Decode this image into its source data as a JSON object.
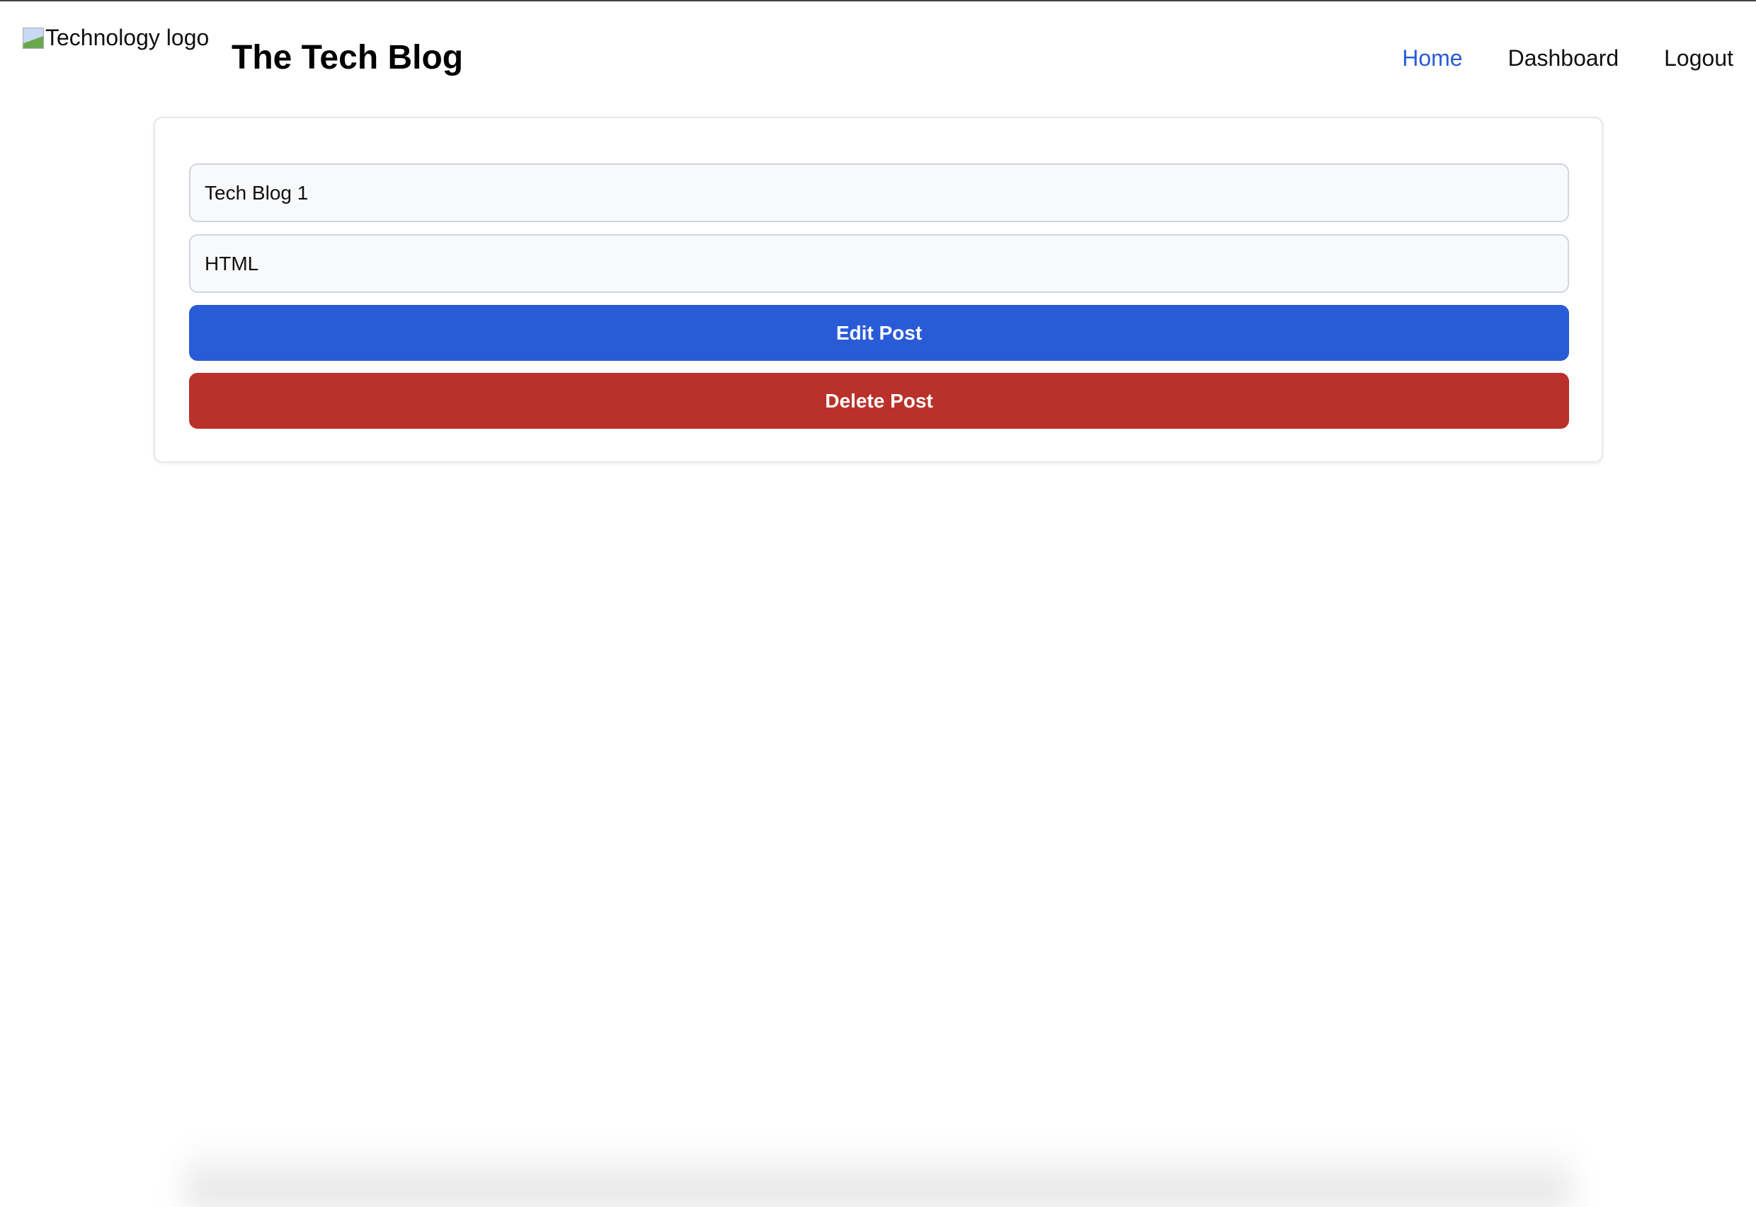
{
  "header": {
    "logo_alt": "Technology logo",
    "title": "The Tech Blog",
    "nav": [
      {
        "label": "Home",
        "active": true
      },
      {
        "label": "Dashboard"
      },
      {
        "label": "Logout"
      }
    ]
  },
  "form": {
    "title_value": "Tech Blog 1",
    "content_value": "HTML",
    "edit_label": "Edit Post",
    "delete_label": "Delete Post"
  },
  "colors": {
    "accent": "#2a5bd7",
    "danger": "#b9312a"
  }
}
